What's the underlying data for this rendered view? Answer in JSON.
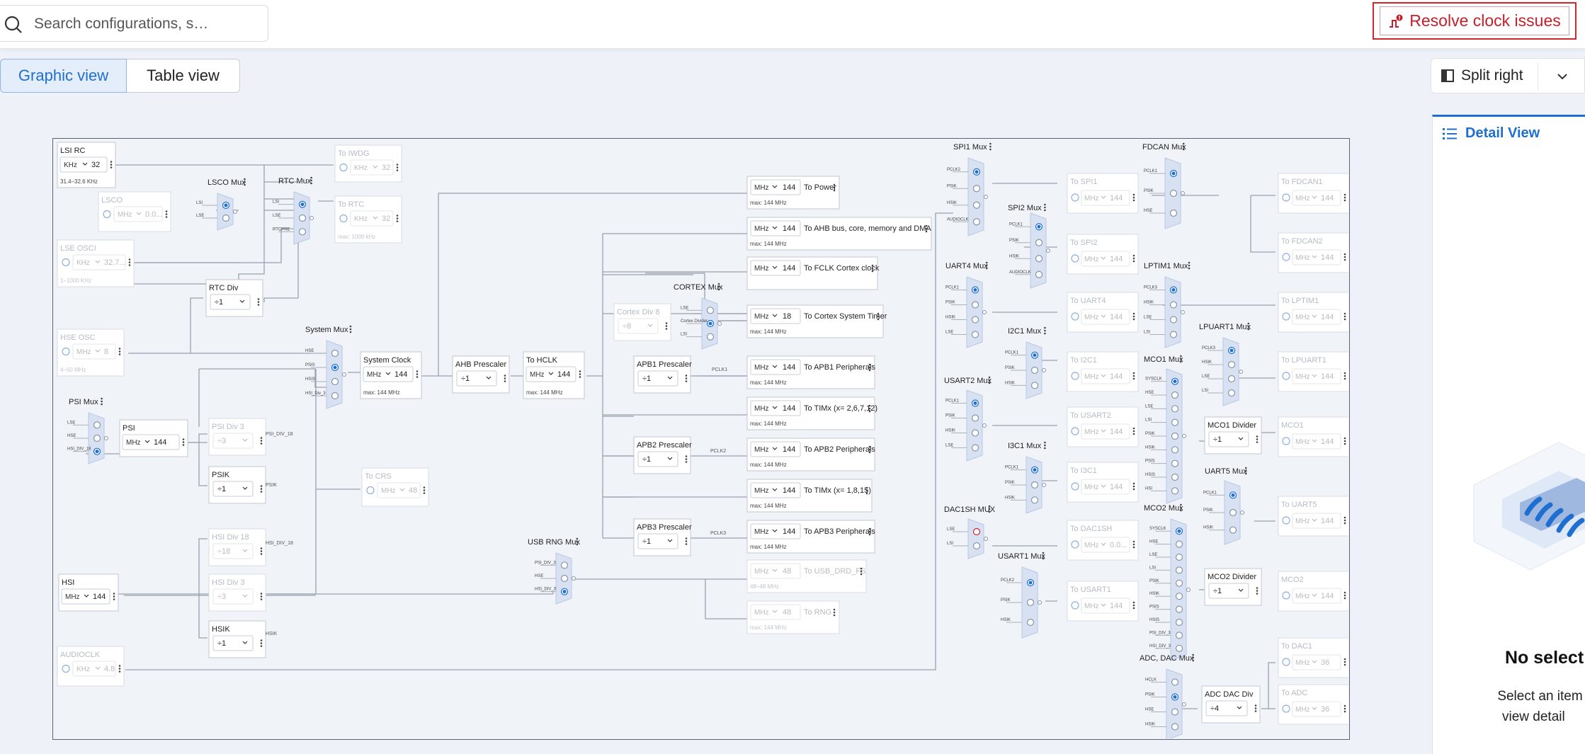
{
  "search": {
    "placeholder": "Search configurations, s…"
  },
  "resolve_button": {
    "label": "Resolve clock issues"
  },
  "view_tabs": [
    {
      "label": "Graphic view"
    },
    {
      "label": "Table view"
    }
  ],
  "split_button": {
    "label": "Split right"
  },
  "detail_panel": {
    "title": "Detail View",
    "empty_title": "No select",
    "empty_desc_line1": "Select an item on t",
    "empty_desc_line2": "view detail"
  },
  "colors": {
    "accent": "#1f6fd1",
    "danger": "#d0262e"
  },
  "diagram": {
    "blocks": [
      {
        "name": "lsi-rc",
        "title": "LSI RC",
        "unit": "KHz",
        "value": "32",
        "sub": "31.4–32.6 KHz"
      },
      {
        "name": "to-iwdg",
        "title": "To IWDG",
        "unit": "KHz",
        "value": "32",
        "disabled": true
      },
      {
        "name": "lsco",
        "title": "LSCO",
        "unit": "MHz",
        "value": "0.0...",
        "disabled": true
      },
      {
        "name": "lse-osc",
        "title": "LSE OSCI",
        "unit": "KHz",
        "value": "32.7...",
        "sub": "1–1000 KHz",
        "disabled": true
      },
      {
        "name": "to-rtc",
        "title": "To RTC",
        "unit": "KHz",
        "value": "32",
        "sub": "max: 1000 kHz",
        "disabled": true
      },
      {
        "name": "rtc-div",
        "title": "RTC Div",
        "unit": "",
        "value": "÷1"
      },
      {
        "name": "hse-osc",
        "title": "HSE OSC",
        "unit": "MHz",
        "value": "8",
        "sub": "4–50 MHz",
        "disabled": true
      },
      {
        "name": "system-clock",
        "title": "System Clock",
        "unit": "MHz",
        "value": "144",
        "sub": "max: 144 MHz"
      },
      {
        "name": "ahb-prescaler",
        "title": "AHB Prescaler",
        "unit": "",
        "value": "÷1"
      },
      {
        "name": "to-hclk",
        "title": "To HCLK",
        "unit": "MHz",
        "value": "144",
        "sub": "max: 144 MHz"
      },
      {
        "name": "cortex-div-8",
        "title": "Cortex Div 8",
        "unit": "",
        "value": "÷8",
        "disabled": true
      },
      {
        "name": "apb1-prescaler",
        "title": "APB1 Prescaler",
        "unit": "",
        "value": "÷1"
      },
      {
        "name": "apb2-prescaler",
        "title": "APB2 Prescaler",
        "unit": "",
        "value": "÷1"
      },
      {
        "name": "apb3-prescaler",
        "title": "APB3 Prescaler",
        "unit": "",
        "value": "÷1"
      },
      {
        "name": "psi",
        "title": "PSI",
        "unit": "MHz",
        "value": "144"
      },
      {
        "name": "psi-div-3",
        "title": "PSI Div 3",
        "unit": "",
        "value": "÷3",
        "disabled": true
      },
      {
        "name": "psik",
        "title": "PSIK",
        "unit": "",
        "value": "÷1"
      },
      {
        "name": "to-crs",
        "title": "To CRS",
        "unit": "MHz",
        "value": "48",
        "disabled": true
      },
      {
        "name": "hsi-div-18",
        "title": "HSI Div 18",
        "unit": "",
        "value": "÷18",
        "disabled": true
      },
      {
        "name": "hsi",
        "title": "HSI",
        "unit": "MHz",
        "value": "144"
      },
      {
        "name": "hsi-div-3",
        "title": "HSI Div 3",
        "unit": "",
        "value": "÷3",
        "disabled": true
      },
      {
        "name": "hsik",
        "title": "HSIK",
        "unit": "",
        "value": "÷1"
      },
      {
        "name": "audioclk",
        "title": "AUDIOCLK",
        "unit": "KHz",
        "value": "4.8",
        "disabled": true
      },
      {
        "name": "mco1-divider",
        "title": "MCO1 Divider",
        "unit": "",
        "value": "÷1"
      },
      {
        "name": "mco2-divider",
        "title": "MCO2 Divider",
        "unit": "",
        "value": "÷1"
      },
      {
        "name": "adc-dac-div",
        "title": "ADC DAC Div",
        "unit": "",
        "value": "÷4"
      }
    ],
    "outputs": [
      {
        "name": "to-power",
        "unit": "MHz",
        "value": "144",
        "label": "To Power",
        "sub": "max: 144 MHz"
      },
      {
        "name": "to-ahb",
        "unit": "MHz",
        "value": "144",
        "label": "To AHB bus, core, memory and DMA",
        "sub": "max: 144 MHz"
      },
      {
        "name": "to-fclk",
        "unit": "MHz",
        "value": "144",
        "label": "To FCLK Cortex clock",
        "sub": ""
      },
      {
        "name": "to-systimer",
        "unit": "MHz",
        "value": "18",
        "label": "To Cortex System Timer",
        "sub": "max: 144 MHz"
      },
      {
        "name": "to-apb1",
        "unit": "MHz",
        "value": "144",
        "label": "To APB1 Peripherals",
        "sub": "max: 144 MHz"
      },
      {
        "name": "to-timx1",
        "unit": "MHz",
        "value": "144",
        "label": "To TIMx (x= 2,6,7,12)",
        "sub": "max: 144 MHz"
      },
      {
        "name": "to-apb2",
        "unit": "MHz",
        "value": "144",
        "label": "To APB2 Peripherals",
        "sub": "max: 144 MHz"
      },
      {
        "name": "to-timx2",
        "unit": "MHz",
        "value": "144",
        "label": "To TIMx (x= 1,8,15)",
        "sub": "max: 144 MHz"
      },
      {
        "name": "to-apb3",
        "unit": "MHz",
        "value": "144",
        "label": "To APB3 Peripherals",
        "sub": "max: 144 MHz"
      },
      {
        "name": "to-usb",
        "unit": "MHz",
        "value": "48",
        "label": "To USB_DRD_FS",
        "sub": "48–48 MHz",
        "disabled": true
      },
      {
        "name": "to-rng",
        "unit": "MHz",
        "value": "48",
        "label": "To RNG",
        "sub": "max: 144 MHz",
        "disabled": true
      }
    ],
    "muxes": [
      {
        "name": "lsco-mux",
        "title": "LSCO Mux",
        "inputs": [
          "LSI",
          "LSE"
        ],
        "selected": 0
      },
      {
        "name": "rtc-mux",
        "title": "RTC Mux",
        "inputs": [
          "LSI",
          "LSE",
          "RTCPRE"
        ],
        "selected": 0
      },
      {
        "name": "system-mux",
        "title": "System Mux",
        "inputs": [
          "HSE",
          "PSIS",
          "HSIS",
          "HSI_Div_3"
        ],
        "selected": 1
      },
      {
        "name": "psi-mux",
        "title": "PSI Mux",
        "inputs": [
          "LSE",
          "HSE",
          "HSI_DIV_18"
        ],
        "selected": 2
      },
      {
        "name": "cortex-mux",
        "title": "CORTEX Mux",
        "inputs": [
          "LSE",
          "Cortex Divider",
          "LSI"
        ],
        "selected": 1
      },
      {
        "name": "usb-rng-mux",
        "title": "USB RNG Mux",
        "inputs": [
          "PSI_DIV_3",
          "HSE",
          "HSI_DIV_3"
        ],
        "selected": 2
      },
      {
        "name": "spi1-mux",
        "title": "SPI1 Mux",
        "inputs": [
          "PCLK2",
          "PSIK",
          "HSIK",
          "AUDIOCLK"
        ],
        "selected": 0
      },
      {
        "name": "spi2-mux",
        "title": "SPI2 Mux",
        "inputs": [
          "PCLK1",
          "PSIK",
          "HSIK",
          "AUDIOCLK"
        ],
        "selected": 0
      },
      {
        "name": "uart4-mux",
        "title": "UART4 Mux",
        "inputs": [
          "PCLK1",
          "PSIK",
          "HSIK",
          "LSE"
        ],
        "selected": 0
      },
      {
        "name": "i2c1-mux",
        "title": "I2C1 Mux",
        "inputs": [
          "PCLK1",
          "PSIK",
          "HSIK"
        ],
        "selected": 0
      },
      {
        "name": "usart2-mux",
        "title": "USART2 Mux",
        "inputs": [
          "PCLK1",
          "PSIK",
          "HSIK",
          "LSE"
        ],
        "selected": 0
      },
      {
        "name": "i3c1-mux",
        "title": "I3C1 Mux",
        "inputs": [
          "PCLK1",
          "PSIK",
          "HSIK"
        ],
        "selected": 0
      },
      {
        "name": "dac1sh-mux",
        "title": "DAC1SH MUX",
        "inputs": [
          "LSE",
          "LSI"
        ],
        "selected": -1
      },
      {
        "name": "usart1-mux",
        "title": "USART1 Mux",
        "inputs": [
          "PCLK2",
          "PSIK",
          "HSIK"
        ],
        "selected": 0
      },
      {
        "name": "fdcan-mux",
        "title": "FDCAN Mux",
        "inputs": [
          "PCLK1",
          "PSIK",
          "HSE"
        ],
        "selected": 0
      },
      {
        "name": "lptim1-mux",
        "title": "LPTIM1 Mux",
        "inputs": [
          "PCLK3",
          "HSIK",
          "LSE",
          "LSI"
        ],
        "selected": 0
      },
      {
        "name": "lpuart1-mux",
        "title": "LPUART1 Mux",
        "inputs": [
          "PCLK3",
          "HSIK",
          "LSE",
          "LSI"
        ],
        "selected": 0
      },
      {
        "name": "mco1-mux",
        "title": "MCO1 Mux",
        "inputs": [
          "SYSCLK",
          "HSE",
          "LSE",
          "LSI",
          "PSIK",
          "HSIK",
          "PSIS",
          "HSIS",
          "HSI"
        ],
        "selected": 0
      },
      {
        "name": "uart5-mux",
        "title": "UART5 Mux",
        "inputs": [
          "PCLK1",
          "PSIK",
          "HSIK"
        ],
        "selected": 0
      },
      {
        "name": "mco2-mux",
        "title": "MCO2 Mux",
        "inputs": [
          "SYSCLK",
          "HSE",
          "LSE",
          "LSI",
          "PSIK",
          "HSIK",
          "PSIS",
          "HSIS",
          "PSI_DIV_3",
          "HSI_DIV_3"
        ],
        "selected": 0
      },
      {
        "name": "adc-dac-mux",
        "title": "ADC, DAC Mux",
        "inputs": [
          "HCLK",
          "PSIK",
          "HSE",
          "HSIK"
        ],
        "selected": 1
      }
    ],
    "periph_outputs": [
      {
        "name": "to-spi1",
        "label": "To SPI1",
        "value": "144"
      },
      {
        "name": "to-spi2",
        "label": "To SPI2",
        "value": "144"
      },
      {
        "name": "to-uart4",
        "label": "To UART4",
        "value": "144"
      },
      {
        "name": "to-i2c1",
        "label": "To I2C1",
        "value": "144"
      },
      {
        "name": "to-usart2",
        "label": "To USART2",
        "value": "144"
      },
      {
        "name": "to-i3c1",
        "label": "To I3C1",
        "value": "144"
      },
      {
        "name": "to-dac1sh",
        "label": "To DAC1SH",
        "value": "0.0..."
      },
      {
        "name": "to-usart1",
        "label": "To USART1",
        "value": "144"
      },
      {
        "name": "to-fdcan1",
        "label": "To FDCAN1",
        "value": "144"
      },
      {
        "name": "to-fdcan2",
        "label": "To FDCAN2",
        "value": "144"
      },
      {
        "name": "to-lptim1",
        "label": "To LPTIM1",
        "value": "144"
      },
      {
        "name": "to-lpuart1",
        "label": "To LPUART1",
        "value": "144"
      },
      {
        "name": "mco1",
        "label": "MCO1",
        "value": "144"
      },
      {
        "name": "to-uart5",
        "label": "To UART5",
        "value": "144"
      },
      {
        "name": "mco2",
        "label": "MCO2",
        "value": "144"
      },
      {
        "name": "to-dac1",
        "label": "To DAC1",
        "value": "36"
      },
      {
        "name": "to-adc",
        "label": "To ADC",
        "value": "36"
      }
    ],
    "signal_labels": {
      "pclk1": "PCLK1",
      "pclk2": "PCLK2",
      "pclk3": "PCLK3",
      "psi_div_18": "PSI_DIV_18",
      "psik": "PSIK",
      "hsi_div_18": "HSI_DIV_18",
      "hsik": "HSIK"
    }
  }
}
